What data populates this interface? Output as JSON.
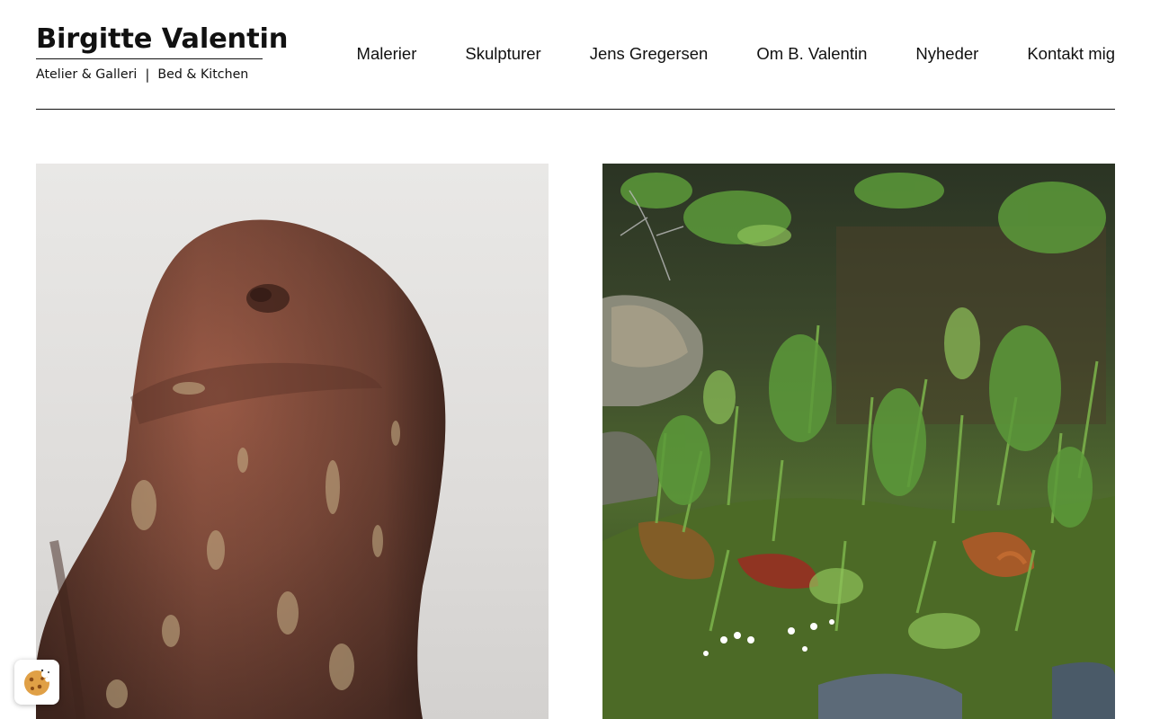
{
  "brand": {
    "title": "Birgitte Valentin",
    "subtitle_left": "Atelier & Galleri",
    "separator": "|",
    "subtitle_right": "Bed & Kitchen"
  },
  "nav": {
    "items": [
      {
        "label": "Malerier"
      },
      {
        "label": "Skulpturer"
      },
      {
        "label": "Jens Gregersen"
      },
      {
        "label": "Om B. Valentin"
      },
      {
        "label": "Nyheder"
      },
      {
        "label": "Kontakt mig"
      }
    ]
  },
  "gallery": {
    "items": [
      {
        "subject": "ceramic owl sculpture",
        "icon": "owl-sculpture-image"
      },
      {
        "subject": "forest painting with fox",
        "icon": "forest-painting-image"
      }
    ]
  },
  "cookie": {
    "icon": "cookie-icon"
  },
  "colors": {
    "text": "#111111",
    "background": "#ffffff",
    "accent_cookie": "#e0a046"
  }
}
